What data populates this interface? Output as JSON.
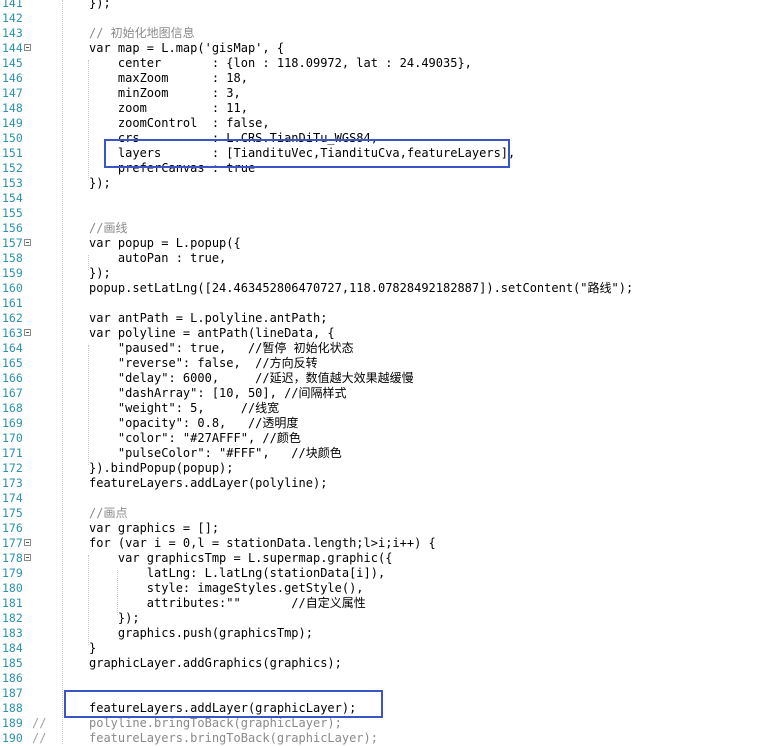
{
  "lines": [
    {
      "n": "141",
      "text": "});",
      "c": "#000"
    },
    {
      "n": "142",
      "text": "",
      "c": "#000"
    },
    {
      "n": "143",
      "text": "// 初始化地图信息",
      "c": "#8a8a8a"
    },
    {
      "n": "144",
      "text": "var map = L.map('gisMap', {",
      "c": "#000"
    },
    {
      "n": "145",
      "text": "    center       : {lon : 118.09972, lat : 24.49035},",
      "c": "#000"
    },
    {
      "n": "146",
      "text": "    maxZoom      : 18,",
      "c": "#000"
    },
    {
      "n": "147",
      "text": "    minZoom      : 3,",
      "c": "#000"
    },
    {
      "n": "148",
      "text": "    zoom         : 11,",
      "c": "#000"
    },
    {
      "n": "149",
      "text": "    zoomControl  : false,",
      "c": "#000"
    },
    {
      "n": "150",
      "text": "    crs          : L.CRS.TianDiTu_WGS84,",
      "c": "#000"
    },
    {
      "n": "151",
      "text": "    layers       : [TiandituVec,TiandituCva,featureLayers],",
      "c": "#000"
    },
    {
      "n": "152",
      "text": "    preferCanvas : true",
      "c": "#000"
    },
    {
      "n": "153",
      "text": "});",
      "c": "#000"
    },
    {
      "n": "154",
      "text": "",
      "c": "#000"
    },
    {
      "n": "155",
      "text": "",
      "c": "#000"
    },
    {
      "n": "156",
      "text": "//画线",
      "c": "#8a8a8a"
    },
    {
      "n": "157",
      "text": "var popup = L.popup({",
      "c": "#000"
    },
    {
      "n": "158",
      "text": "    autoPan : true,",
      "c": "#000"
    },
    {
      "n": "159",
      "text": "});",
      "c": "#000"
    },
    {
      "n": "160",
      "text": "popup.setLatLng([24.463452806470727,118.07828492182887]).setContent(\"路线\");",
      "c": "#000"
    },
    {
      "n": "161",
      "text": "",
      "c": "#000"
    },
    {
      "n": "162",
      "text": "var antPath = L.polyline.antPath;",
      "c": "#000"
    },
    {
      "n": "163",
      "text": "var polyline = antPath(lineData, {",
      "c": "#000"
    },
    {
      "n": "164",
      "text": "    \"paused\": true,   //暂停 初始化状态",
      "c": "#000"
    },
    {
      "n": "165",
      "text": "    \"reverse\": false,  //方向反转",
      "c": "#000"
    },
    {
      "n": "166",
      "text": "    \"delay\": 6000,     //延迟，数值越大效果越缓慢",
      "c": "#000"
    },
    {
      "n": "167",
      "text": "    \"dashArray\": [10, 50], //间隔样式",
      "c": "#000"
    },
    {
      "n": "168",
      "text": "    \"weight\": 5,     //线宽",
      "c": "#000"
    },
    {
      "n": "169",
      "text": "    \"opacity\": 0.8,   //透明度",
      "c": "#000"
    },
    {
      "n": "170",
      "text": "    \"color\": \"#27AFFF\", //颜色",
      "c": "#000"
    },
    {
      "n": "171",
      "text": "    \"pulseColor\": \"#FFF\",   //块颜色",
      "c": "#000"
    },
    {
      "n": "172",
      "text": "}).bindPopup(popup);",
      "c": "#000"
    },
    {
      "n": "173",
      "text": "featureLayers.addLayer(polyline);",
      "c": "#000"
    },
    {
      "n": "174",
      "text": "",
      "c": "#000"
    },
    {
      "n": "175",
      "text": "//画点",
      "c": "#8a8a8a"
    },
    {
      "n": "176",
      "text": "var graphics = [];",
      "c": "#000"
    },
    {
      "n": "177",
      "text": "for (var i = 0,l = stationData.length;l>i;i++) {",
      "c": "#000"
    },
    {
      "n": "178",
      "text": "    var graphicsTmp = L.supermap.graphic({",
      "c": "#000"
    },
    {
      "n": "179",
      "text": "        latLng: L.latLng(stationData[i]),",
      "c": "#000"
    },
    {
      "n": "180",
      "text": "        style: imageStyles.getStyle(),",
      "c": "#000"
    },
    {
      "n": "181",
      "text": "        attributes:\"\"       //自定义属性",
      "c": "#000"
    },
    {
      "n": "182",
      "text": "    });",
      "c": "#000"
    },
    {
      "n": "183",
      "text": "    graphics.push(graphicsTmp);",
      "c": "#000"
    },
    {
      "n": "184",
      "text": "}",
      "c": "#000"
    },
    {
      "n": "185",
      "text": "graphicLayer.addGraphics(graphics);",
      "c": "#000"
    },
    {
      "n": "186",
      "text": "",
      "c": "#000"
    },
    {
      "n": "187",
      "text": "",
      "c": "#000"
    },
    {
      "n": "188",
      "text": "featureLayers.addLayer(graphicLayer);",
      "c": "#000"
    },
    {
      "n": "189",
      "text": "polyline.bringToBack(graphicLayer);",
      "c": "#8a8a8a",
      "prefix": "//"
    },
    {
      "n": "190",
      "text": "featureLayers.bringToBack(graphicLayer);",
      "c": "#8a8a8a",
      "prefix": "//"
    }
  ],
  "fold_markers": [
    "144",
    "157",
    "163",
    "177",
    "178"
  ],
  "highlight_color": "#3a55c8"
}
